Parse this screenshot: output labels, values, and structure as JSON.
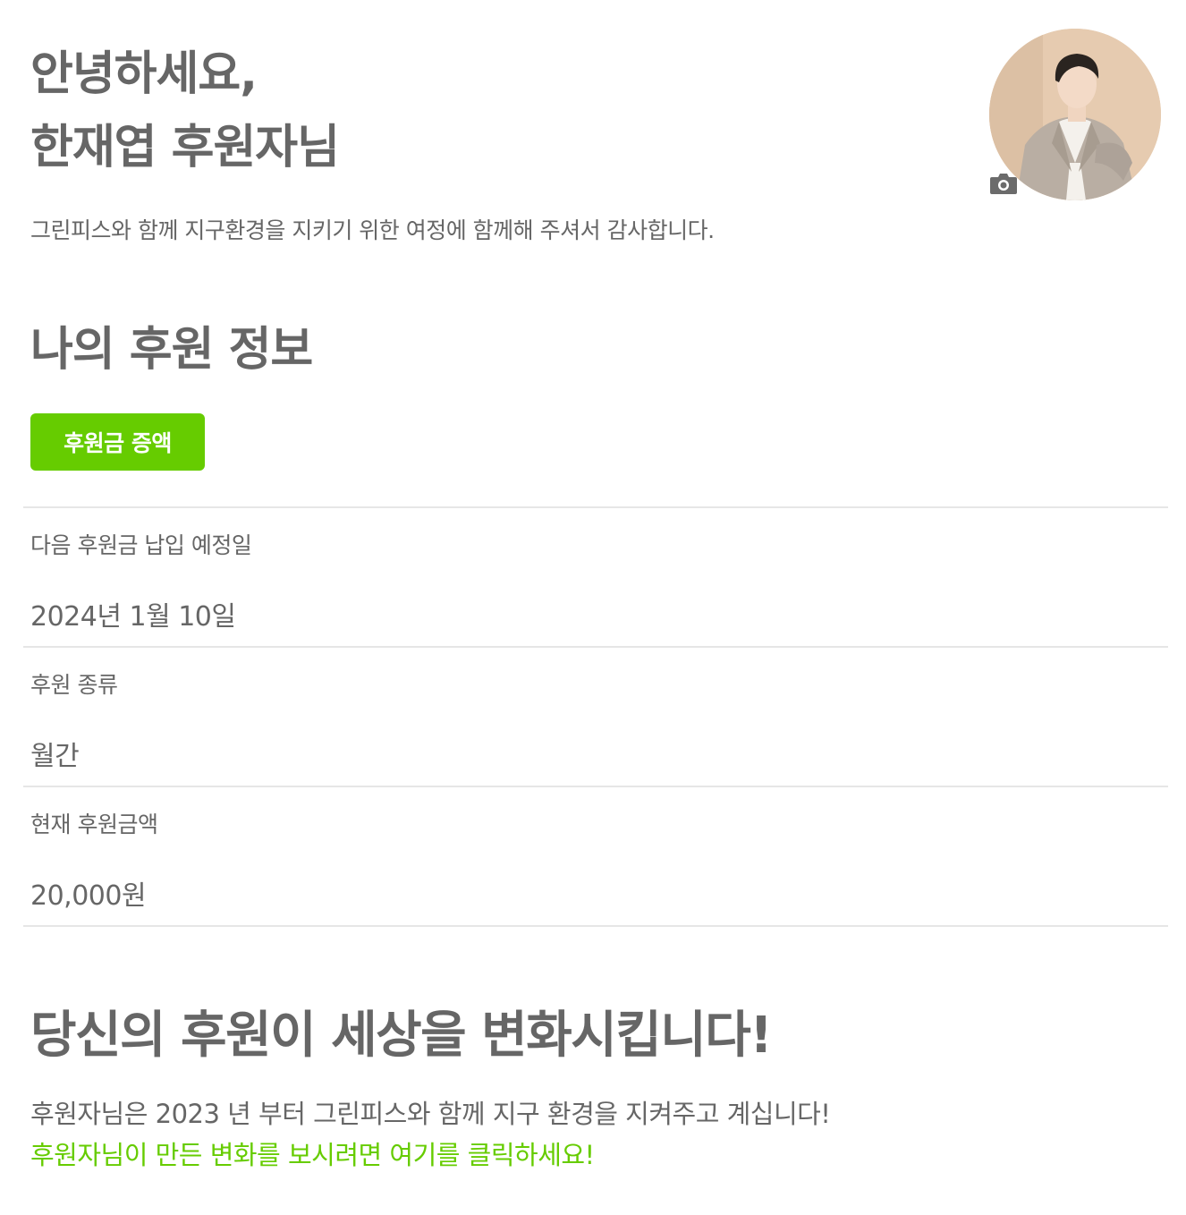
{
  "header": {
    "greeting_line1": "안녕하세요,",
    "greeting_line2": "한재엽 후원자님",
    "subtext": "그린피스와 함께 지구환경을 지키기 위한 여정에 함께해 주셔서 감사합니다."
  },
  "profile": {
    "avatar_icon": "user-photo",
    "camera_icon": "camera-icon"
  },
  "donation_info": {
    "title": "나의 후원 정보",
    "increase_button_label": "후원금 증액",
    "rows": [
      {
        "label": "다음 후원금 납입 예정일",
        "value": "2024년 1월 10일"
      },
      {
        "label": "후원 종류",
        "value": "월간"
      },
      {
        "label": "현재 후원금액",
        "value": "20,000원"
      }
    ]
  },
  "impact": {
    "title": "당신의 후원이 세상을 변화시킵니다!",
    "text": "후원자님은 2023 년 부터 그린피스와 함께 지구 환경을 지켜주고 계십니다!",
    "link_text": "후원자님이 만든 변화를 보시려면 여기를 클릭하세요!"
  },
  "colors": {
    "accent": "#66cc00",
    "text": "#666666",
    "divider": "#e6e6e6"
  }
}
